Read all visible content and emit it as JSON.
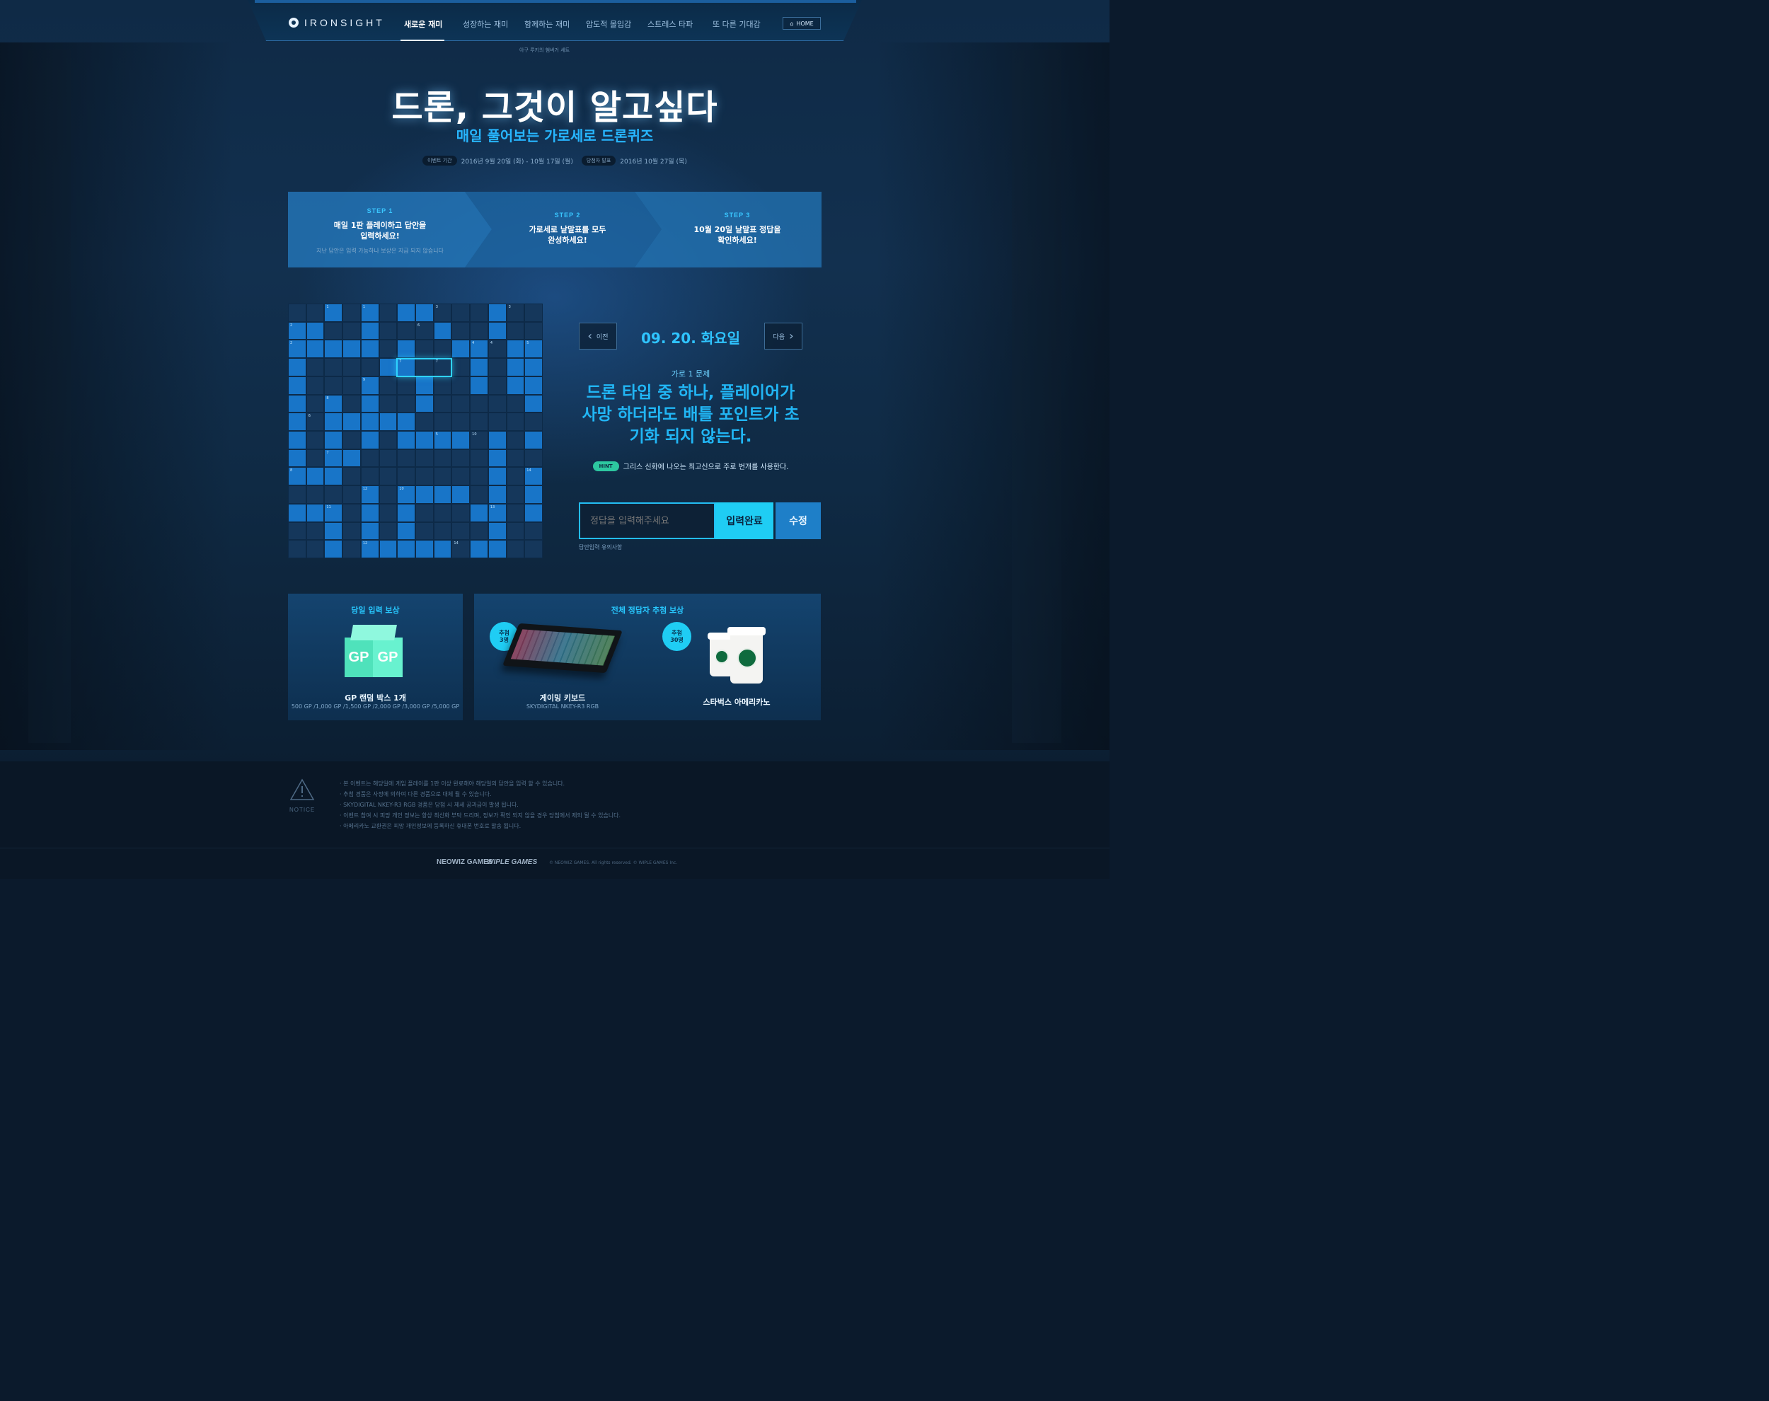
{
  "nav": {
    "logo": "IRONSIGHT",
    "items": [
      "새로운 재미",
      "성장하는 재미",
      "함께하는 재미",
      "압도적 몰입감",
      "스트레스 타파",
      "또 다른 기대감"
    ],
    "home": "HOME",
    "subnote": "아구 루키의 햄버거 세트"
  },
  "hero": {
    "title": "드론, 그것이 알고싶다",
    "subtitle": "매일 풀어보는 가로세로 드론퀴즈",
    "period_label": "이벤트 기간",
    "period": "2016년 9월 20일 (화) - 10월 17일 (월)",
    "announce_label": "당첨자 발표",
    "announce": "2016년 10월 27일 (목)"
  },
  "steps": [
    {
      "no": "STEP 1",
      "text": "매일 1판 플레이하고 답안을 입력하세요!",
      "note": "지난 답안은 입력 가능하나 보상은 지급 되지 않습니다"
    },
    {
      "no": "STEP 2",
      "text": "가로세로 낱말표를 모두 완성하세요!",
      "note": ""
    },
    {
      "no": "STEP 3",
      "text": "10월 20일 낱말표 정답을 확인하세요!",
      "note": ""
    }
  ],
  "crossword": {
    "size": 14,
    "rows": [
      "..#.#.##...#..",
      "##..#...#..#..",
      "#####.#..##.##",
      "#....##...#.##",
      "#...#..#..#.##",
      "#.#.#..#.....#",
      "#.#####.......",
      "#.#.#.####.#.#",
      "#.##.......#..",
      "###........#.#",
      "....#.####.#.#",
      "###.#.#...##.#",
      "..#.#.#....#..",
      "..#.#####.##.."
    ],
    "numbers": [
      {
        "r": 0,
        "c": 2,
        "n": "1"
      },
      {
        "r": 0,
        "c": 4,
        "n": "1"
      },
      {
        "r": 0,
        "c": 8,
        "n": "3"
      },
      {
        "r": 0,
        "c": 12,
        "n": "3"
      },
      {
        "r": 1,
        "c": 0,
        "n": "2"
      },
      {
        "r": 1,
        "c": 7,
        "n": "6"
      },
      {
        "r": 2,
        "c": 0,
        "n": "2"
      },
      {
        "r": 2,
        "c": 10,
        "n": "4"
      },
      {
        "r": 2,
        "c": 11,
        "n": "4"
      },
      {
        "r": 2,
        "c": 13,
        "n": "5"
      },
      {
        "r": 3,
        "c": 6,
        "n": "7"
      },
      {
        "r": 3,
        "c": 8,
        "n": "7"
      },
      {
        "r": 4,
        "c": 4,
        "n": "9"
      },
      {
        "r": 5,
        "c": 2,
        "n": "8"
      },
      {
        "r": 6,
        "c": 1,
        "n": "6"
      },
      {
        "r": 7,
        "c": 8,
        "n": "5"
      },
      {
        "r": 7,
        "c": 10,
        "n": "10"
      },
      {
        "r": 8,
        "c": 2,
        "n": "7"
      },
      {
        "r": 9,
        "c": 0,
        "n": "8"
      },
      {
        "r": 9,
        "c": 13,
        "n": "14"
      },
      {
        "r": 10,
        "c": 4,
        "n": "12"
      },
      {
        "r": 10,
        "c": 6,
        "n": "10"
      },
      {
        "r": 11,
        "c": 2,
        "n": "11"
      },
      {
        "r": 11,
        "c": 11,
        "n": "13"
      },
      {
        "r": 13,
        "c": 4,
        "n": "12"
      },
      {
        "r": 13,
        "c": 9,
        "n": "14"
      }
    ]
  },
  "question": {
    "prev": "이전",
    "next": "다음",
    "date": "09. 20. 화요일",
    "label": "가로 1 문제",
    "text": "드론 타입 중 하나, 플레이어가 사망 하더라도 배틀 포인트가 초기화 되지 않는다.",
    "hint_badge": "HINT",
    "hint": "그리스 신화에 나오는 최고신으로 주로 번개를 사용한다.",
    "input_placeholder": "정답을 입력해주세요",
    "submit": "입력완료",
    "edit": "수정",
    "note": "답안입력 유의사항"
  },
  "rewards": {
    "daily": {
      "title": "당일 입력 보상",
      "gp_label": "GP",
      "name": "GP 랜덤 박스 1개",
      "detail": "500 GP /1,000 GP /1,500 GP /2,000 GP /3,000 GP /5,000 GP"
    },
    "lottery": {
      "title": "전체 정답자 추첨 보상",
      "items": [
        {
          "badge_top": "추첨",
          "badge_bottom": "3명",
          "name": "게이밍 키보드",
          "sub": "SKYDIGITAL NKEY-R3 RGB"
        },
        {
          "badge_top": "추첨",
          "badge_bottom": "30명",
          "name": "스타벅스 아메리카노",
          "sub": ""
        }
      ]
    }
  },
  "footer": {
    "notice_label": "NOTICE",
    "notices": [
      "본 이벤트는 해당일에 게임 플레이를 1판 이상 완료해야 해당일의 답안을 입력 할 수 있습니다.",
      "추첨 경품은 사정에 의하여 다른 경품으로 대체 될 수 있습니다.",
      "SKYDIGITAL NKEY-R3 RGB 경품은 당첨 시 제세 공과금이 발생 됩니다.",
      "이벤트 참여 시 피망 개인 정보는 항상 최신화 부탁 드리며, 정보가 확인 되지 않을 경우 당첨에서 제외 될 수 있습니다.",
      "아메리카노 교환권은 피망 개인정보에 등록하신 휴대폰 번호로 발송 됩니다."
    ],
    "corp1": "NEOWIZ GAMES",
    "corp2": "WIPLE GAMES",
    "copyright": "© NEOWIZ GAMES. All rights reserved.   © WIPLE GAMES Inc."
  },
  "colors": {
    "accent": "#21b6f5",
    "cell_on": "#1875c8",
    "cell_off": "#15375b",
    "submit": "#1fcdf4",
    "hint": "#2dc7a0"
  }
}
